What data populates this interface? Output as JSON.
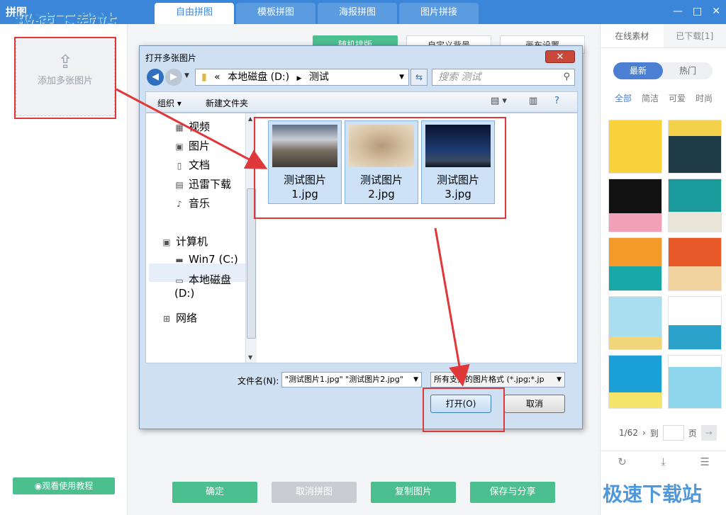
{
  "app": {
    "title": "拼图",
    "watermark": "极速下载站",
    "tabs": [
      "自由拼图",
      "模板拼图",
      "海报拼图",
      "图片拼接"
    ],
    "active_tab_index": 0,
    "window_buttons": {
      "minimize": "—",
      "maximize": "□",
      "close": "✕"
    }
  },
  "left_panel": {
    "add_label": "添加多张图片",
    "tutorial_label": "观看使用教程"
  },
  "center": {
    "random_layout": "随机排版",
    "custom_bg": "自定义背景",
    "canvas_settings": "画布设置",
    "buttons": {
      "confirm": "确定",
      "cancel_collage": "取消拼图",
      "copy_image": "复制图片",
      "save_share": "保存与分享"
    }
  },
  "right_panel": {
    "tabs": [
      "在线素材",
      "已下载[1]"
    ],
    "filters": [
      "最新",
      "热门"
    ],
    "categories": [
      "全部",
      "简洁",
      "可爱",
      "时尚"
    ],
    "pager": {
      "current": "1/62",
      "goto_label": "到",
      "page_unit": "页"
    }
  },
  "dialog": {
    "title": "打开多张图片",
    "close": "✕",
    "breadcrumb": [
      "«",
      "本地磁盘 (D:)",
      "测试"
    ],
    "search_placeholder": "搜索 测试",
    "toolbar": {
      "organize": "组织 ▾",
      "new_folder": "新建文件夹"
    },
    "nav_items": [
      {
        "label": "视频",
        "icon": "video-icon"
      },
      {
        "label": "图片",
        "icon": "picture-icon"
      },
      {
        "label": "文档",
        "icon": "document-icon"
      },
      {
        "label": "迅雷下载",
        "icon": "download-icon"
      },
      {
        "label": "音乐",
        "icon": "music-icon"
      },
      {
        "label": "计算机",
        "icon": "computer-icon"
      },
      {
        "label": "Win7 (C:)",
        "icon": "drive-icon"
      },
      {
        "label": "本地磁盘 (D:)",
        "icon": "disk-icon"
      },
      {
        "label": "网络",
        "icon": "network-icon"
      }
    ],
    "files": [
      {
        "line1": "测试图片",
        "line2": "1.jpg"
      },
      {
        "line1": "测试图片",
        "line2": "2.jpg"
      },
      {
        "line1": "测试图片",
        "line2": "3.jpg"
      }
    ],
    "filename_label": "文件名(N):",
    "filename_value": "\"测试图片1.jpg\" \"测试图片2.jpg\"",
    "filetype_value": "所有支持的图片格式 (*.jpg;*.jp",
    "open_button": "打开(O)",
    "cancel_button": "取消"
  },
  "colors": {
    "titlebar": "#3c86d9",
    "accent_green": "#4cbf8f",
    "accent_blue": "#4a7fd3",
    "annotation_red": "#e0373a"
  }
}
